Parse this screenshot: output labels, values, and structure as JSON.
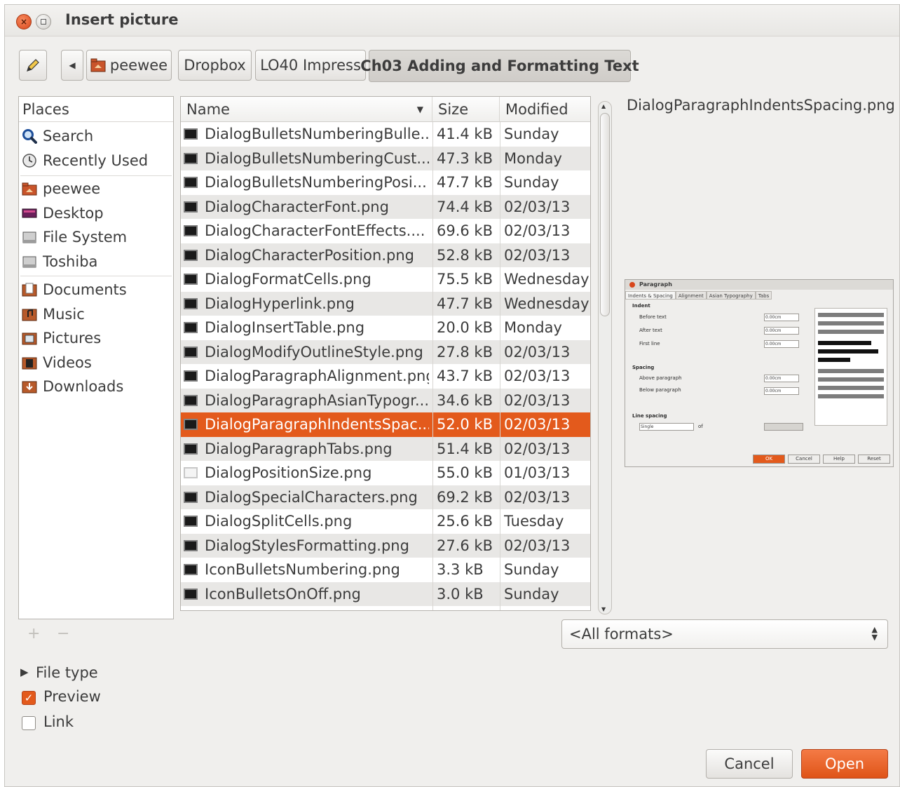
{
  "window": {
    "title": "Insert picture"
  },
  "path_bar": {
    "segments": [
      "peewee",
      "Dropbox",
      "LO40 Impress",
      "Ch03 Adding and Formatting Text"
    ]
  },
  "places": {
    "header": "Places",
    "group1": [
      "Search",
      "Recently Used"
    ],
    "group2": [
      "peewee",
      "Desktop",
      "File System",
      "Toshiba"
    ],
    "group3": [
      "Documents",
      "Music",
      "Pictures",
      "Videos",
      "Downloads"
    ],
    "add_label": "+",
    "remove_label": "−"
  },
  "file_list": {
    "columns": {
      "name": "Name",
      "size": "Size",
      "modified": "Modified"
    },
    "rows": [
      {
        "name": "DialogBulletsNumberingBulle...",
        "size": "41.4 kB",
        "modified": "Sunday"
      },
      {
        "name": "DialogBulletsNumberingCust...",
        "size": "47.3 kB",
        "modified": "Monday"
      },
      {
        "name": "DialogBulletsNumberingPosi...",
        "size": "47.7 kB",
        "modified": "Sunday"
      },
      {
        "name": "DialogCharacterFont.png",
        "size": "74.4 kB",
        "modified": "02/03/13"
      },
      {
        "name": "DialogCharacterFontEffects....",
        "size": "69.6 kB",
        "modified": "02/03/13"
      },
      {
        "name": "DialogCharacterPosition.png",
        "size": "52.8 kB",
        "modified": "02/03/13"
      },
      {
        "name": "DialogFormatCells.png",
        "size": "75.5 kB",
        "modified": "Wednesday"
      },
      {
        "name": "DialogHyperlink.png",
        "size": "47.7 kB",
        "modified": "Wednesday"
      },
      {
        "name": "DialogInsertTable.png",
        "size": "20.0 kB",
        "modified": "Monday"
      },
      {
        "name": "DialogModifyOutlineStyle.png",
        "size": "27.8 kB",
        "modified": "02/03/13"
      },
      {
        "name": "DialogParagraphAlignment.png",
        "size": "43.7 kB",
        "modified": "02/03/13"
      },
      {
        "name": "DialogParagraphAsianTypogr...",
        "size": "34.6 kB",
        "modified": "02/03/13"
      },
      {
        "name": "DialogParagraphIndentsSpac...",
        "size": "52.0 kB",
        "modified": "02/03/13",
        "selected": true
      },
      {
        "name": "DialogParagraphTabs.png",
        "size": "51.4 kB",
        "modified": "02/03/13"
      },
      {
        "name": "DialogPositionSize.png",
        "size": "55.0 kB",
        "modified": "01/03/13",
        "light_icon": true
      },
      {
        "name": "DialogSpecialCharacters.png",
        "size": "69.2 kB",
        "modified": "02/03/13"
      },
      {
        "name": "DialogSplitCells.png",
        "size": "25.6 kB",
        "modified": "Tuesday"
      },
      {
        "name": "DialogStylesFormatting.png",
        "size": "27.6 kB",
        "modified": "02/03/13"
      },
      {
        "name": "IconBulletsNumbering.png",
        "size": "3.3 kB",
        "modified": "Sunday"
      },
      {
        "name": "IconBulletsOnOff.png",
        "size": "3.0 kB",
        "modified": "Sunday"
      }
    ]
  },
  "preview": {
    "filename": "DialogParagraphIndentsSpacing.png",
    "dialog_title": "Paragraph",
    "tabs": [
      "Indents & Spacing",
      "Alignment",
      "Asian Typography",
      "Tabs"
    ],
    "indent_label": "Indent",
    "before_text": "Before text",
    "after_text": "After text",
    "first_line": "First line",
    "spacing_label": "Spacing",
    "above_paragraph": "Above paragraph",
    "below_paragraph": "Below paragraph",
    "line_spacing_label": "Line spacing",
    "line_spacing_value": "Single",
    "of_label": "of",
    "value": "0.00cm",
    "ok": "OK",
    "cancel": "Cancel",
    "help": "Help",
    "reset": "Reset"
  },
  "filter": {
    "selected": "<All formats>"
  },
  "options": {
    "file_type": "File type",
    "preview": "Preview",
    "preview_checked": true,
    "link": "Link",
    "link_checked": false
  },
  "actions": {
    "cancel": "Cancel",
    "open": "Open"
  },
  "colors": {
    "accent": "#e35a1c",
    "window_bg": "#f0efed"
  }
}
